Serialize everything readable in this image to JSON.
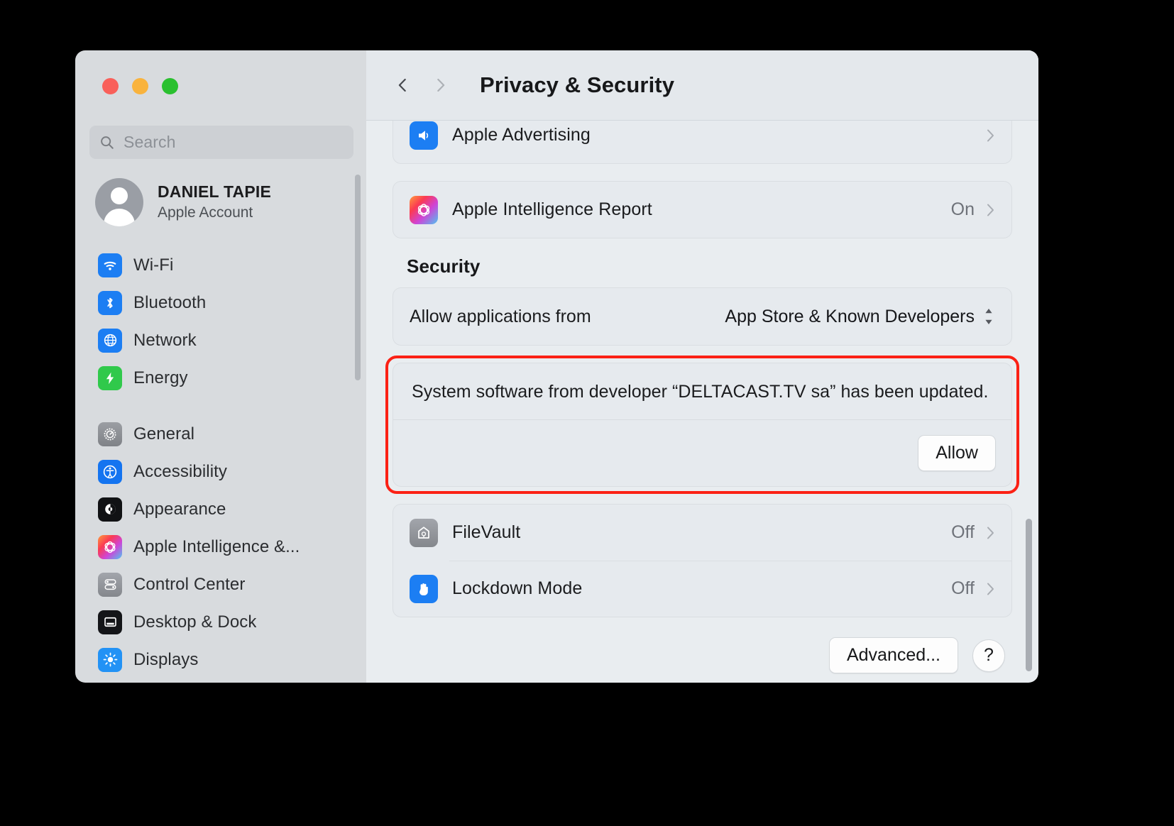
{
  "window": {
    "traffic_lights": [
      "close",
      "minimize",
      "zoom"
    ],
    "colors": {
      "close": "#f9605a",
      "minimize": "#f9b33d",
      "zoom": "#2ac02f",
      "highlight": "#fb2115"
    }
  },
  "sidebar": {
    "search": {
      "placeholder": "Search",
      "icon": "search-icon"
    },
    "account": {
      "name": "DANIEL TAPIE",
      "subtitle": "Apple Account",
      "avatar": "person-avatar"
    },
    "groups": [
      {
        "items": [
          {
            "label": "Wi-Fi",
            "icon": "wifi-icon"
          },
          {
            "label": "Bluetooth",
            "icon": "bluetooth-icon"
          },
          {
            "label": "Network",
            "icon": "globe-icon"
          },
          {
            "label": "Energy",
            "icon": "bolt-icon"
          }
        ]
      },
      {
        "items": [
          {
            "label": "General",
            "icon": "gear-icon"
          },
          {
            "label": "Accessibility",
            "icon": "accessibility-icon"
          },
          {
            "label": "Appearance",
            "icon": "appearance-icon"
          },
          {
            "label": "Apple Intelligence &...",
            "icon": "apple-intelligence-icon"
          },
          {
            "label": "Control Center",
            "icon": "control-center-icon"
          },
          {
            "label": "Desktop & Dock",
            "icon": "desktop-dock-icon"
          },
          {
            "label": "Displays",
            "icon": "displays-icon"
          }
        ]
      }
    ]
  },
  "toolbar": {
    "back_icon": "chevron-left-icon",
    "forward_icon": "chevron-right-icon",
    "title": "Privacy & Security"
  },
  "main": {
    "privacy_rows": [
      {
        "label": "Apple Advertising",
        "value": "",
        "icon": "apple-advertising-icon",
        "disclosure": "chevron-right-icon"
      },
      {
        "label": "Apple Intelligence Report",
        "value": "On",
        "icon": "apple-intelligence-icon",
        "disclosure": "chevron-right-icon"
      }
    ],
    "security": {
      "heading": "Security",
      "allow_label": "Allow applications from",
      "allow_value": "App Store & Known Developers",
      "allow_control_icon": "stepper-updown-icon",
      "alert": {
        "message": "System software from developer “DELTACAST.TV sa” has been updated.",
        "allow_button": "Allow"
      },
      "rows": [
        {
          "label": "FileVault",
          "value": "Off",
          "icon": "filevault-icon",
          "disclosure": "chevron-right-icon"
        },
        {
          "label": "Lockdown Mode",
          "value": "Off",
          "icon": "lockdown-mode-icon",
          "disclosure": "chevron-right-icon"
        }
      ]
    },
    "footer": {
      "advanced_button": "Advanced...",
      "help_button": "?"
    }
  }
}
